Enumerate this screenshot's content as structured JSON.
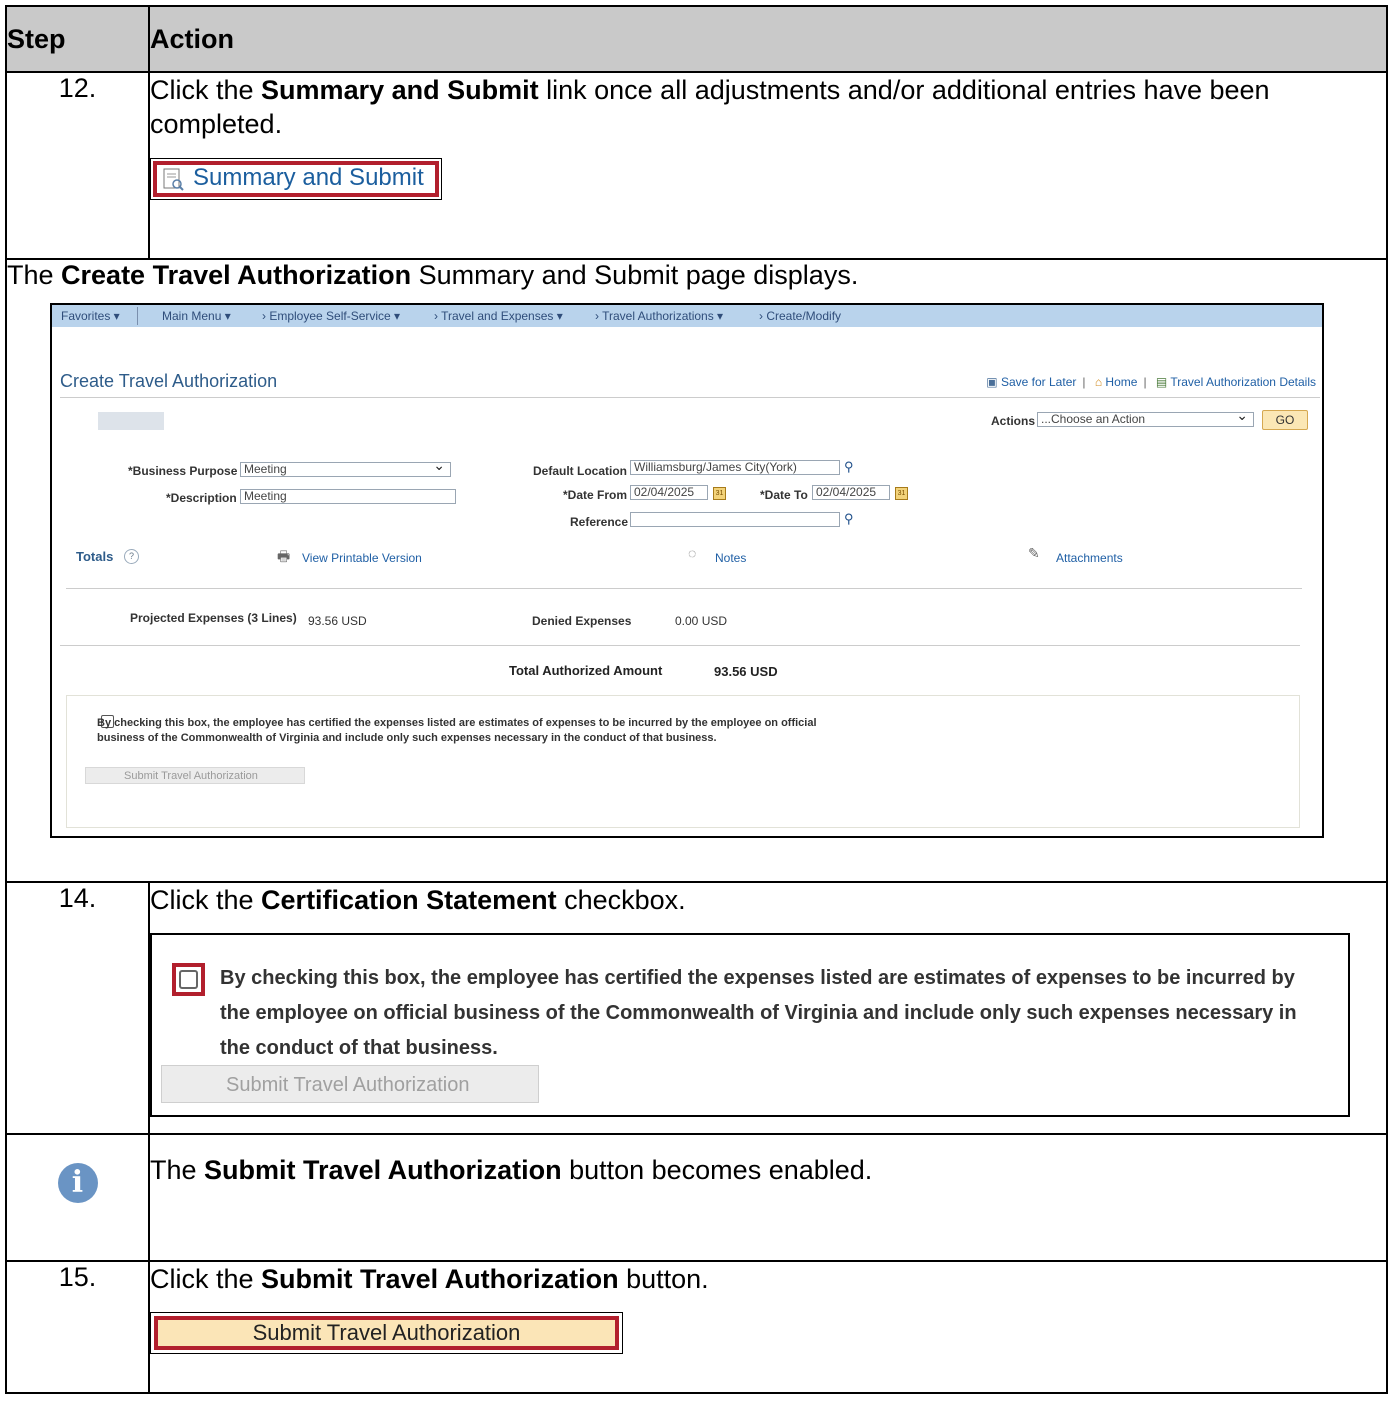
{
  "header": {
    "step": "Step",
    "action": "Action"
  },
  "step12": {
    "num": "12.",
    "pre": "Click the ",
    "bold": "Summary and Submit",
    "post": " link once all adjustments and/or additional entries have been completed.",
    "link_label": "Summary and Submit"
  },
  "intro": {
    "pre": "The ",
    "bold": "Create Travel Authorization",
    "post": " Summary and Submit page displays."
  },
  "screen": {
    "nav": {
      "favorites": "Favorites ▾",
      "main_menu": "Main Menu ▾",
      "crumbs": [
        "›  Employee Self-Service ▾",
        "›  Travel and Expenses ▾",
        "›  Travel Authorizations ▾",
        "›  Create/Modify"
      ]
    },
    "title": "Create Travel Authorization",
    "links": {
      "save": "Save for Later",
      "home": "Home",
      "details": "Travel Authorization Details"
    },
    "actions_label": "Actions",
    "actions_value": "...Choose an Action",
    "go": "GO",
    "business_purpose_label": "*Business Purpose",
    "business_purpose_value": "Meeting",
    "description_label": "*Description",
    "description_value": "Meeting",
    "default_location_label": "Default Location",
    "default_location_value": "Williamsburg/James City(York)",
    "date_from_label": "*Date From",
    "date_from_value": "02/04/2025",
    "date_to_label": "*Date To",
    "date_to_value": "02/04/2025",
    "reference_label": "Reference",
    "totals": "Totals",
    "view_printable": "View Printable Version",
    "notes": "Notes",
    "attachments": "Attachments",
    "projected_label": "Projected Expenses (3 Lines)",
    "projected_value": "93.56  USD",
    "denied_label": "Denied Expenses",
    "denied_value": "0.00  USD",
    "total_label": "Total Authorized Amount",
    "total_value": "93.56  USD",
    "cert_text": "By checking this box, the employee has certified the expenses listed are estimates of expenses to be incurred by the employee on official business of the Commonwealth of Virginia and include only such expenses necessary in the conduct of that business.",
    "submit_label": "Submit Travel Authorization"
  },
  "step14": {
    "num": "14.",
    "pre": "Click the ",
    "bold": "Certification Statement",
    "post": " checkbox.",
    "cert_text": "By checking this box, the employee has certified the expenses listed are estimates of expenses to be incurred by the employee on official business of the Commonwealth of Virginia and include only such expenses necessary in the conduct of that business.",
    "submit_label": "Submit Travel Authorization"
  },
  "note": {
    "pre": "The ",
    "bold": "Submit Travel Authorization",
    "post": " button becomes enabled."
  },
  "step15": {
    "num": "15.",
    "pre": "Click the ",
    "bold": "Submit Travel Authorization",
    "post": " button.",
    "button_label": "Submit Travel Authorization"
  },
  "colors": {
    "callout_red": "#b21f2d",
    "header_gray": "#c9c9c9",
    "nav_blue": "#b9d3ec",
    "info_blue": "#6a94c4"
  }
}
